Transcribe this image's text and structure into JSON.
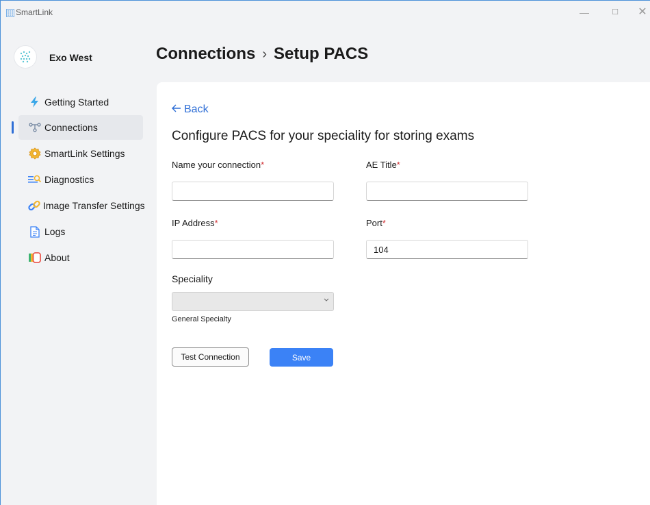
{
  "window": {
    "title": "SmartLink",
    "controls": {
      "minimize": "—",
      "maximize": "☐",
      "close": "✕"
    }
  },
  "sidebar": {
    "org_name": "Exo West",
    "items": [
      {
        "label": "Getting Started",
        "icon": "lightning-icon",
        "active": false
      },
      {
        "label": "Connections",
        "icon": "network-icon",
        "active": true
      },
      {
        "label": "SmartLink Settings",
        "icon": "gear-icon",
        "active": false
      },
      {
        "label": "Diagnostics",
        "icon": "diagnostics-icon",
        "active": false
      },
      {
        "label": "Image Transfer Settings",
        "icon": "link-icon",
        "active": false
      },
      {
        "label": "Logs",
        "icon": "document-icon",
        "active": false
      },
      {
        "label": "About",
        "icon": "about-icon",
        "active": false
      }
    ]
  },
  "header": {
    "breadcrumb_parent": "Connections",
    "breadcrumb_separator": "›",
    "breadcrumb_current": "Setup PACS"
  },
  "main": {
    "back_label": "Back",
    "heading": "Configure PACS for your speciality for storing exams",
    "fields": {
      "connection_name": {
        "label": "Name your connection",
        "required_mark": "*",
        "value": ""
      },
      "ae_title": {
        "label": "AE Title",
        "required_mark": "*",
        "value": ""
      },
      "ip_address": {
        "label": "IP Address",
        "required_mark": "*",
        "value": ""
      },
      "port": {
        "label": "Port",
        "required_mark": "*",
        "value": "104"
      },
      "speciality": {
        "label": "Speciality",
        "selected": "",
        "caption": "General Specialty"
      }
    },
    "buttons": {
      "test_connection": "Test Connection",
      "save": "Save"
    }
  },
  "colors": {
    "accent": "#2f6fd6",
    "primary_button": "#3b82f6",
    "required": "#d13438"
  }
}
